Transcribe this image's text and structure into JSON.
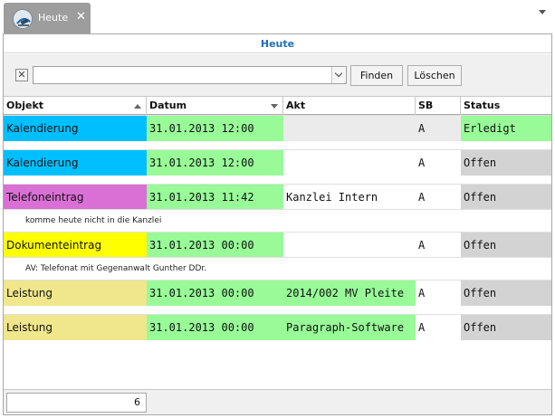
{
  "tab": {
    "label": "Heute",
    "close": "✕",
    "icon": "judge-gavel-icon"
  },
  "panel": {
    "title": "Heute"
  },
  "filter": {
    "clear_label": "✕",
    "search_value": "",
    "search_placeholder": "",
    "find_label": "Finden",
    "delete_label": "Löschen"
  },
  "columns": [
    "Objekt",
    "Datum",
    "Akt",
    "SB",
    "Status"
  ],
  "colors": {
    "blue": "#00bfff",
    "magenta": "#da70d6",
    "yellow": "#ffff00",
    "khaki": "#f0e68c",
    "green": "#98fb98",
    "grey": "#d3d3d3",
    "white": "#ffffff",
    "selected": "#ebebeb",
    "title_blue": "#1e6fb8"
  },
  "rows": [
    {
      "objekt": "Kalendierung",
      "datum": "31.01.2013 12:00",
      "akt": "",
      "sb": "A",
      "status": "Erledigt",
      "objekt_color": "#00bfff",
      "akt_color": "#ebebeb",
      "sb_color": "#ebebeb",
      "status_color": "#98fb98",
      "note": ""
    },
    {
      "objekt": "Kalendierung",
      "datum": "31.01.2013 12:00",
      "akt": "",
      "sb": "A",
      "status": "Offen",
      "objekt_color": "#00bfff",
      "akt_color": "#ffffff",
      "sb_color": "#ffffff",
      "status_color": "#d3d3d3",
      "note": ""
    },
    {
      "objekt": "Telefoneintrag",
      "datum": "31.01.2013 11:42",
      "akt": "Kanzlei Intern",
      "sb": "A",
      "status": "Offen",
      "objekt_color": "#da70d6",
      "akt_color": "#ffffff",
      "sb_color": "#ffffff",
      "status_color": "#d3d3d3",
      "note": "komme heute nicht in die Kanzlei"
    },
    {
      "objekt": "Dokumenteintrag",
      "datum": "31.01.2013 00:00",
      "akt": "",
      "sb": "A",
      "status": "Offen",
      "objekt_color": "#ffff00",
      "akt_color": "#ffffff",
      "sb_color": "#ffffff",
      "status_color": "#d3d3d3",
      "note": "AV: Telefonat mit Gegenanwalt Gunther DDr."
    },
    {
      "objekt": "Leistung",
      "datum": "31.01.2013 00:00",
      "akt": "2014/002 MV Pleite",
      "sb": "A",
      "status": "Offen",
      "objekt_color": "#f0e68c",
      "akt_color": "#98fb98",
      "sb_color": "#ffffff",
      "status_color": "#d3d3d3",
      "note": ""
    },
    {
      "objekt": "Leistung",
      "datum": "31.01.2013 00:00",
      "akt": "Paragraph-Software",
      "sb": "A",
      "status": "Offen",
      "objekt_color": "#f0e68c",
      "akt_color": "#98fb98",
      "sb_color": "#ffffff",
      "status_color": "#d3d3d3",
      "note": ""
    }
  ],
  "footer": {
    "count": "6"
  }
}
